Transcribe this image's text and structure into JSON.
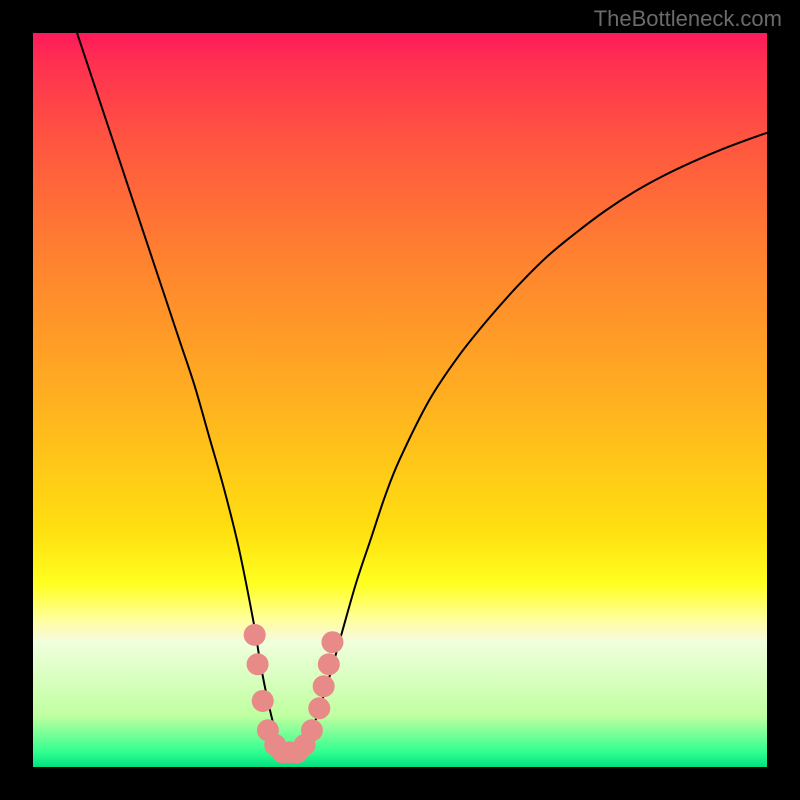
{
  "watermark": "TheBottleneck.com",
  "chart_data": {
    "type": "line",
    "title": "",
    "xlabel": "",
    "ylabel": "",
    "xlim": [
      0,
      100
    ],
    "ylim": [
      0,
      100
    ],
    "series": [
      {
        "name": "bottleneck-curve",
        "x": [
          6,
          8,
          10,
          12,
          14,
          16,
          18,
          20,
          22,
          24,
          26,
          28,
          30,
          31,
          32,
          33,
          34,
          35,
          36,
          37,
          38,
          40,
          42,
          44,
          46,
          48,
          50,
          54,
          58,
          62,
          66,
          70,
          74,
          78,
          82,
          86,
          90,
          94,
          98,
          100
        ],
        "values": [
          100,
          94,
          88,
          82,
          76,
          70,
          64,
          58,
          52,
          45,
          38,
          30,
          20,
          14,
          9,
          5,
          3,
          2,
          2,
          3,
          5,
          11,
          18,
          25,
          31,
          37,
          42,
          50,
          56,
          61,
          65.5,
          69.5,
          72.8,
          75.8,
          78.4,
          80.6,
          82.5,
          84.2,
          85.7,
          86.4
        ]
      }
    ],
    "markers": {
      "name": "highlight-points",
      "color": "#e88a88",
      "points": [
        {
          "x": 30.2,
          "y": 18
        },
        {
          "x": 30.6,
          "y": 14
        },
        {
          "x": 31.3,
          "y": 9
        },
        {
          "x": 32.0,
          "y": 5
        },
        {
          "x": 33.0,
          "y": 3
        },
        {
          "x": 34.0,
          "y": 2
        },
        {
          "x": 35.0,
          "y": 2
        },
        {
          "x": 36.0,
          "y": 2
        },
        {
          "x": 37.0,
          "y": 3
        },
        {
          "x": 38.0,
          "y": 5
        },
        {
          "x": 39.0,
          "y": 8
        },
        {
          "x": 39.6,
          "y": 11
        },
        {
          "x": 40.3,
          "y": 14
        },
        {
          "x": 40.8,
          "y": 17
        }
      ]
    },
    "gradient_stops": [
      {
        "pos": 0,
        "color": "#ff1a5b"
      },
      {
        "pos": 50,
        "color": "#ffb020"
      },
      {
        "pos": 75,
        "color": "#ffff20"
      },
      {
        "pos": 100,
        "color": "#00e080"
      }
    ]
  }
}
